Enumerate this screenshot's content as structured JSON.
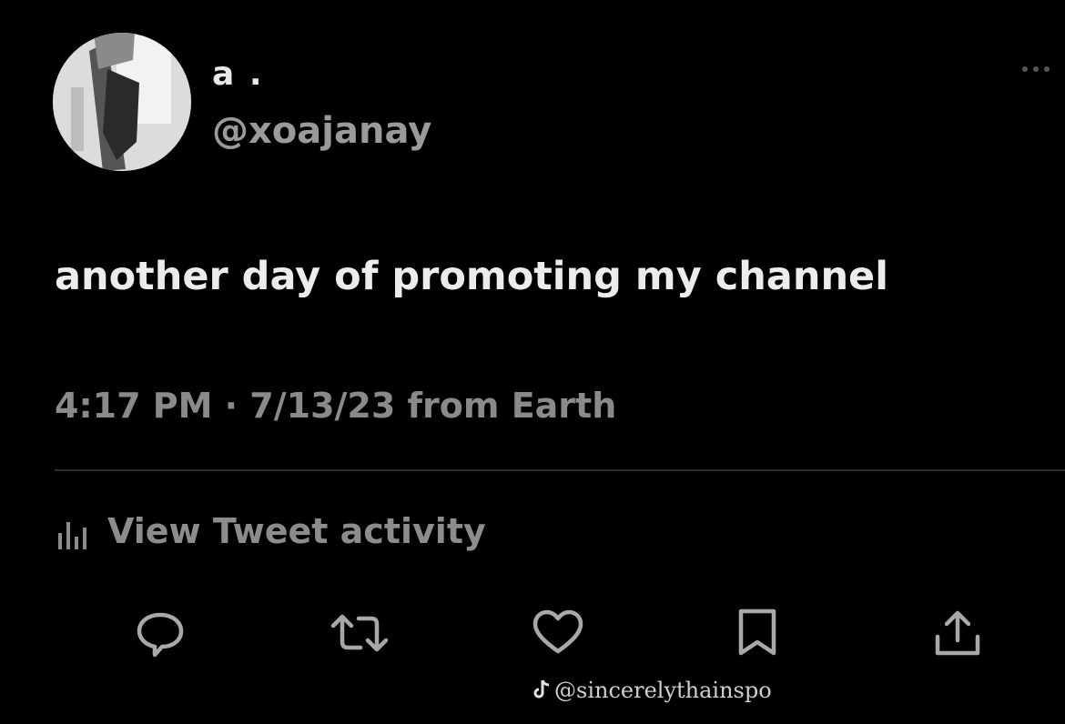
{
  "tweet": {
    "display_name": "a .",
    "handle": "@xoajanay",
    "text": "another day of promoting my channel",
    "timestamp": "4:17 PM · 7/13/23 from Earth"
  },
  "activity": {
    "label": "View Tweet activity",
    "icon": "bar-chart-icon"
  },
  "actions": [
    {
      "name": "reply",
      "icon": "reply-icon"
    },
    {
      "name": "retweet",
      "icon": "retweet-icon"
    },
    {
      "name": "like",
      "icon": "heart-icon"
    },
    {
      "name": "bookmark",
      "icon": "bookmark-icon"
    },
    {
      "name": "share",
      "icon": "share-icon"
    }
  ],
  "watermark": {
    "text": "@sincerelythainspo"
  },
  "colors": {
    "background": "#000000",
    "primary_text": "#ececec",
    "secondary_text": "#8a8a8a",
    "icon": "#9a9a9a"
  }
}
